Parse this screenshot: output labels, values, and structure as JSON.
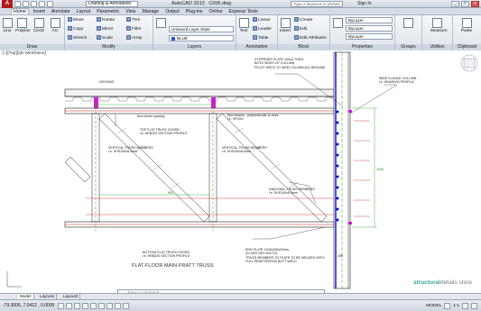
{
  "window": {
    "title": "AutoCAD 2013",
    "filename": "C006.dwg",
    "workspace": "Drafting & Annotation",
    "search_placeholder": "Type a keyword or phrase",
    "sign_in": "Sign In",
    "controls": [
      "_",
      "□",
      "✕"
    ]
  },
  "ribbon_tabs": [
    "Home",
    "Insert",
    "Annotate",
    "Layout",
    "Parametric",
    "View",
    "Manage",
    "Output",
    "Plug-ins",
    "Online",
    "Express Tools"
  ],
  "active_tab": "Home",
  "panels": {
    "draw": {
      "title": "Draw",
      "tools": [
        "Line",
        "Polyline",
        "Circle",
        "Arc"
      ]
    },
    "modify": {
      "title": "Modify",
      "tools": [
        "Move",
        "Rotate",
        "Trim",
        "Copy",
        "Mirror",
        "Fillet",
        "Stretch",
        "Scale",
        "Array"
      ]
    },
    "layers": {
      "title": "Layers",
      "state": "Unsaved Layer State",
      "current": "BLUE"
    },
    "annotation": {
      "title": "Annotation",
      "tools": [
        "Text",
        "Linear",
        "Leader",
        "Table"
      ]
    },
    "block": {
      "title": "Block",
      "tools": [
        "Insert",
        "Create",
        "Edit",
        "Edit Attributes"
      ]
    },
    "properties": {
      "title": "Properties",
      "values": [
        "ByLayer",
        "ByLayer",
        "ByLayer"
      ]
    },
    "groups": {
      "title": "Groups",
      "tools": [
        "Group"
      ]
    },
    "utilities": {
      "title": "Utilities",
      "tools": [
        "Measure"
      ]
    },
    "clipboard": {
      "title": "Clipboard",
      "tools": [
        "Paste"
      ]
    }
  },
  "viewport": {
    "label": "[–][Top][2D Wireframe]",
    "viewcube_label": "TOP",
    "wcs": "WCS"
  },
  "drawing": {
    "title": "FLAT FLOOR MAIN PRATT TRUSS",
    "notes": {
      "decking": "DECKING",
      "stiffener": [
        "STIFFENER PLATE 10mm THICK",
        "BOTH SIDES OF COLUMN",
        "FILLET WELD TO WEB COLUMN ALL AROUND"
      ],
      "wide_flange": [
        "WIDE FLANGE COLUMN",
        "i.e. HEA/B200 PROFILE"
      ],
      "floor_beam_spacing": "floor beam spacing",
      "floor_beams": [
        "floor beams - perpendicular to truss",
        "i.e. IPE200"
      ],
      "top_truss": [
        "TOP FLAT TRUSS CHORD",
        "i.e. HEB220 SECTION PROFILE"
      ],
      "vertical_members_left": [
        "VERTICAL TRUSS MEMBERS",
        "i.e. SHS100x8.0mm"
      ],
      "vertical_members_right": [
        "VERTICAL TRUSS MEMBERS",
        "i.e. SHS100x8.0mm"
      ],
      "diagonal_members": [
        "DIAGONAL TRUSS MEMBERS",
        "i.e. SHS100x8.0mm"
      ],
      "bottom_truss": [
        "BOTTOM FLAT TRUSS CHORD",
        "i.e. HEB220 SECTION PROFILE"
      ],
      "end_plate": [
        "END PLATE 1040x250x20mm",
        "(2x M20 HEX BOLTS)",
        "TRUSS MEMBERS TO PLATE TO BE WELDED WITH",
        "FULL PENETRATION BUTT WELD"
      ],
      "dim_900": "900",
      "dim_250": "250",
      "dim_1040": "1040"
    },
    "watermark_bold": "structural",
    "watermark_light": "details store"
  },
  "layout_tabs": [
    "Model",
    "Layout1",
    "Layout2"
  ],
  "active_layout": "Model",
  "command_placeholder": "Type a command",
  "status": {
    "coords": "-79.3006, 7.0412 , 0.0000",
    "model_label": "MODEL",
    "scale": "1:1"
  },
  "colors": {
    "accent": "#2b5797",
    "magenta": "#d21bd2",
    "green": "#1fa01f",
    "red": "#d01818",
    "blue_bolts": "#1010c8"
  }
}
